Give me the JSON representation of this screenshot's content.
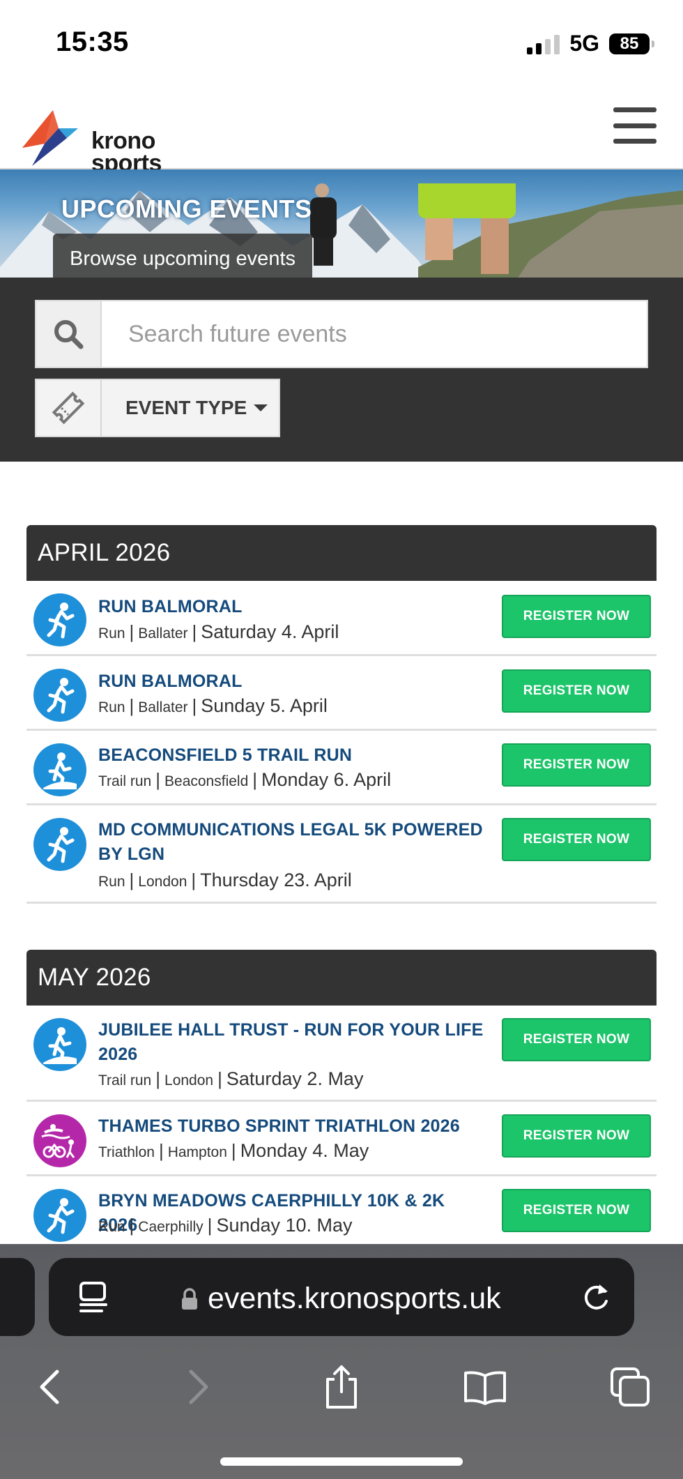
{
  "status_bar": {
    "time": "15:35",
    "network": "5G",
    "battery": "85"
  },
  "header": {
    "logo_line1": "krono",
    "logo_line2": "sports",
    "menu_icon": "hamburger-icon"
  },
  "hero": {
    "title": "UPCOMING EVENTS",
    "subtitle": "Browse upcoming events"
  },
  "search": {
    "placeholder": "Search future events",
    "value": "",
    "icon": "search-icon"
  },
  "filter": {
    "label": "EVENT TYPE",
    "icon": "ticket-icon"
  },
  "months": [
    {
      "label": "APRIL 2026",
      "events": [
        {
          "title": "RUN BALMORAL",
          "type": "Run",
          "location": "Ballater",
          "date": "Saturday 4. April",
          "button": "REGISTER NOW",
          "icon": "runner-icon"
        },
        {
          "title": "RUN BALMORAL",
          "type": "Run",
          "location": "Ballater",
          "date": "Sunday 5. April",
          "button": "REGISTER NOW",
          "icon": "runner-icon"
        },
        {
          "title": "BEACONSFIELD 5 TRAIL RUN",
          "type": "Trail run",
          "location": "Beaconsfield",
          "date": "Monday 6. April",
          "button": "REGISTER NOW",
          "icon": "trail-runner-icon"
        },
        {
          "title": "MD COMMUNICATIONS LEGAL 5K POWERED BY LGN",
          "type": "Run",
          "location": "London",
          "date": "Thursday 23. April",
          "button": "REGISTER NOW",
          "icon": "runner-icon"
        }
      ]
    },
    {
      "label": "MAY 2026",
      "events": [
        {
          "title": "JUBILEE HALL TRUST - RUN FOR YOUR LIFE 2026",
          "type": "Trail run",
          "location": "London",
          "date": "Saturday 2. May",
          "button": "REGISTER NOW",
          "icon": "trail-runner-icon"
        },
        {
          "title": "THAMES TURBO SPRINT TRIATHLON 2026",
          "type": "Triathlon",
          "location": "Hampton",
          "date": "Monday 4. May",
          "button": "REGISTER NOW",
          "icon": "triathlon-icon"
        },
        {
          "title": "BRYN MEADOWS CAERPHILLY 10K & 2K 2026",
          "type": "Run",
          "location": "Caerphilly",
          "date": "Sunday 10. May",
          "button": "REGISTER NOW",
          "icon": "runner-icon"
        }
      ]
    }
  ],
  "browser": {
    "url": "events.kronosports.uk"
  },
  "colors": {
    "accent_green": "#1cc46a",
    "title_blue": "#144a7c",
    "icon_blue": "#1e8fd9",
    "icon_purple": "#b527a9",
    "panel_dark": "#333333"
  }
}
